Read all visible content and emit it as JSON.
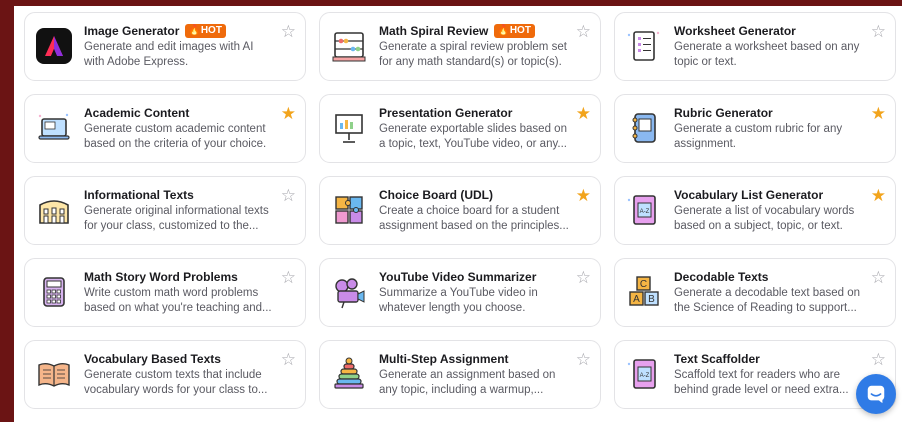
{
  "tools": [
    {
      "title": "Image Generator",
      "hot": "🔥HOT",
      "desc": "Generate and edit images with AI with Adobe Express.",
      "icon": "adobe-express-icon",
      "starred": false
    },
    {
      "title": "Math Spiral Review",
      "hot": "🔥HOT",
      "desc": "Generate a spiral review problem set for any math standard(s) or topic(s).",
      "icon": "abacus-icon",
      "starred": false
    },
    {
      "title": "Worksheet Generator",
      "hot": "",
      "desc": "Generate a worksheet based on any topic or text.",
      "icon": "worksheet-icon",
      "starred": false
    },
    {
      "title": "Academic Content",
      "hot": "",
      "desc": "Generate custom academic content based on the criteria of your choice.",
      "icon": "laptop-icon",
      "starred": true
    },
    {
      "title": "Presentation Generator",
      "hot": "",
      "desc": "Generate exportable slides based on a topic, text, YouTube video, or any...",
      "icon": "presentation-icon",
      "starred": true
    },
    {
      "title": "Rubric Generator",
      "hot": "",
      "desc": "Generate a custom rubric for any assignment.",
      "icon": "notebook-icon",
      "starred": true
    },
    {
      "title": "Informational Texts",
      "hot": "",
      "desc": "Generate original informational texts for your class, customized to the...",
      "icon": "colosseum-icon",
      "starred": false
    },
    {
      "title": "Choice Board (UDL)",
      "hot": "",
      "desc": "Create a choice board for a student assignment based on the principles...",
      "icon": "puzzle-icon",
      "starred": true
    },
    {
      "title": "Vocabulary List Generator",
      "hot": "",
      "desc": "Generate a list of vocabulary words based on a subject, topic, or text.",
      "icon": "dictionary-icon",
      "starred": true
    },
    {
      "title": "Math Story Word Problems",
      "hot": "",
      "desc": "Write custom math word problems based on what you're teaching and...",
      "icon": "calculator-icon",
      "starred": false
    },
    {
      "title": "YouTube Video Summarizer",
      "hot": "",
      "desc": "Summarize a YouTube video in whatever length you choose.",
      "icon": "camera-icon",
      "starred": false
    },
    {
      "title": "Decodable Texts",
      "hot": "",
      "desc": "Generate a decodable text based on the Science of Reading to support...",
      "icon": "abc-blocks-icon",
      "starred": false
    },
    {
      "title": "Vocabulary Based Texts",
      "hot": "",
      "desc": "Generate custom texts that include vocabulary words for your class to...",
      "icon": "open-book-icon",
      "starred": false
    },
    {
      "title": "Multi-Step Assignment",
      "hot": "",
      "desc": "Generate an assignment based on any topic, including a warmup,...",
      "icon": "stacking-rings-icon",
      "starred": false
    },
    {
      "title": "Text Scaffolder",
      "hot": "",
      "desc": "Scaffold text for readers who are behind grade level or need extra...",
      "icon": "dictionary-icon",
      "starred": false
    }
  ],
  "star_empty": "☆",
  "star_filled": "★",
  "colors": {
    "star_on": "#f2a41c",
    "star_off": "#a7a7ad",
    "hot": "#ef6a0b",
    "chat": "#2f7be6"
  }
}
